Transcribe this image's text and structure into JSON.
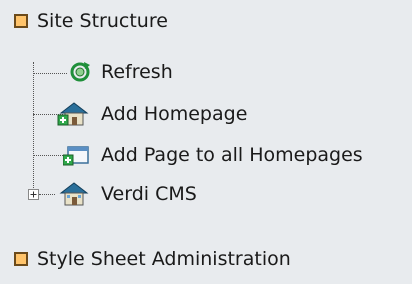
{
  "sections": [
    {
      "label": "Site Structure",
      "color": "#ffc46b"
    },
    {
      "label": "Style Sheet Administration",
      "color": "#ffc46b"
    }
  ],
  "tree": {
    "items": [
      {
        "label": "Refresh",
        "icon": "refresh-icon"
      },
      {
        "label": "Add Homepage",
        "icon": "add-homepage-icon"
      },
      {
        "label": "Add Page to all Homepages",
        "icon": "add-page-icon"
      },
      {
        "label": "Verdi CMS",
        "icon": "homepage-icon",
        "expander": "plus"
      }
    ]
  }
}
